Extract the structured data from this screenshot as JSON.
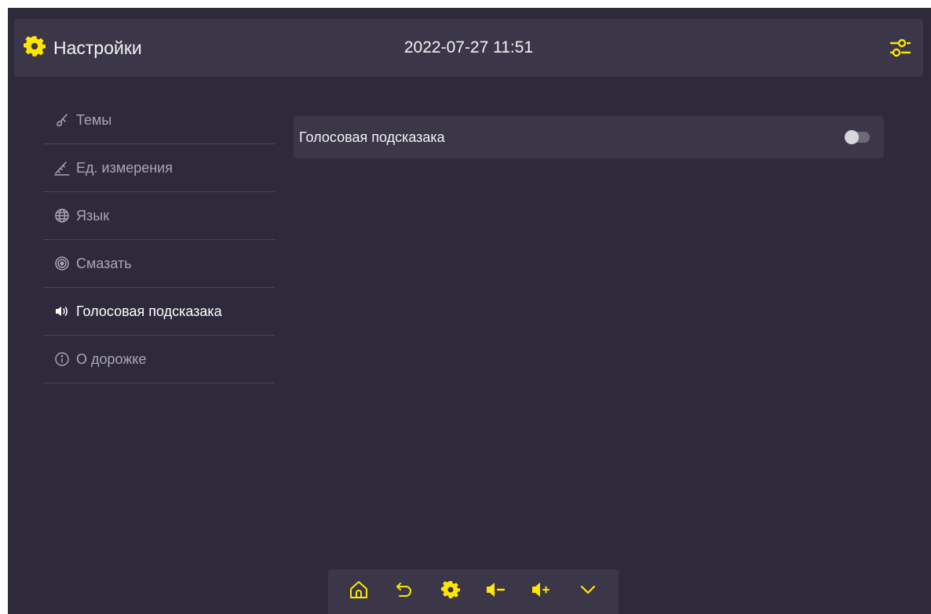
{
  "colors": {
    "accent": "#ffe600",
    "background": "#2e2a3c",
    "panel": "#3b3749"
  },
  "header": {
    "title": "Настройки",
    "title_icon": "gear-icon",
    "datetime": "2022-07-27 11:51",
    "settings_icon": "sliders-icon"
  },
  "sidebar": {
    "items": [
      {
        "label": "Темы",
        "icon": "paint-icon",
        "active": false
      },
      {
        "label": "Ед. измерения",
        "icon": "ruler-icon",
        "active": false
      },
      {
        "label": "Язык",
        "icon": "globe-icon",
        "active": false
      },
      {
        "label": "Смазать",
        "icon": "target-icon",
        "active": false
      },
      {
        "label": "Голосовая подсказака",
        "icon": "speaker-icon",
        "active": true
      },
      {
        "label": "О дорожке",
        "icon": "info-icon",
        "active": false
      }
    ]
  },
  "content": {
    "voice_prompt": {
      "label": "Голосовая подсказака",
      "enabled": false
    }
  },
  "bottom_bar": {
    "buttons": [
      {
        "icon": "home-icon"
      },
      {
        "icon": "back-icon"
      },
      {
        "icon": "gear-icon"
      },
      {
        "icon": "volume-down-icon"
      },
      {
        "icon": "volume-up-icon"
      },
      {
        "icon": "chevron-down-icon"
      }
    ]
  }
}
